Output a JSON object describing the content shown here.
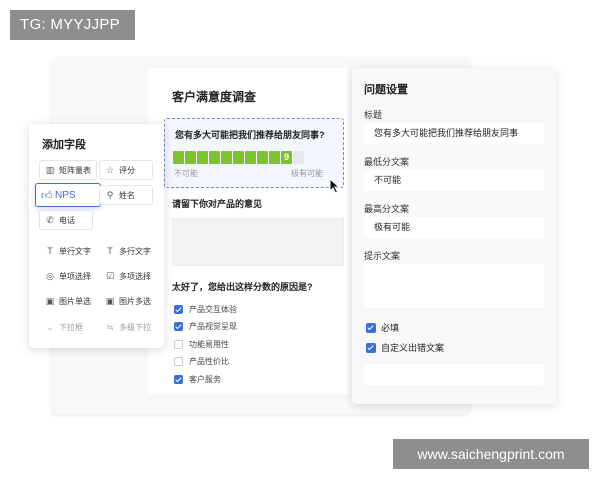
{
  "watermarks": {
    "top": "TG: MYYJJPP",
    "bottom": "www.saichengprint.com"
  },
  "form": {
    "title": "客户满意度调查",
    "nps_question": {
      "label": "您有多大可能把我们推荐给朋友同事?",
      "selected_score": "9",
      "min_label": "不可能",
      "max_label": "极有可能"
    },
    "text_question": {
      "label": "请留下你对产品的意见"
    },
    "reason_question": {
      "label": "太好了，您给出这样分数的原因是?",
      "options": [
        {
          "label": "产品交互体验",
          "checked": true
        },
        {
          "label": "产品视觉呈现",
          "checked": true
        },
        {
          "label": "功能易用性",
          "checked": false
        },
        {
          "label": "产品性价比",
          "checked": false
        },
        {
          "label": "客户服务",
          "checked": true
        }
      ]
    }
  },
  "add_field_panel": {
    "title": "添加字段",
    "buttons": [
      {
        "label": "矩阵量表",
        "icon": "matrix-icon"
      },
      {
        "label": "评分",
        "icon": "star-icon"
      },
      {
        "label": "NPS",
        "icon": "thumbs-up-icon"
      },
      {
        "label": "姓名",
        "icon": "person-icon"
      },
      {
        "label": "电话",
        "icon": "phone-icon"
      },
      {
        "label": "单行文字",
        "icon": "text-icon"
      },
      {
        "label": "多行文字",
        "icon": "text-icon"
      },
      {
        "label": "单项选择",
        "icon": "check-circle-icon"
      },
      {
        "label": "多项选择",
        "icon": "check-square-icon"
      },
      {
        "label": "图片单选",
        "icon": "image-icon"
      },
      {
        "label": "图片多选",
        "icon": "image-icon"
      },
      {
        "label": "下拉框",
        "icon": "chevron-down-icon"
      },
      {
        "label": "多级下拉",
        "icon": "hierarchy-icon"
      }
    ]
  },
  "settings_panel": {
    "title": "问题设置",
    "title_label": "标题",
    "title_value": "您有多大可能把我们推荐给朋友同事",
    "min_label": "最低分文案",
    "min_value": "不可能",
    "max_label": "最高分文案",
    "max_value": "极有可能",
    "hint_label": "提示文案",
    "required_label": "必填",
    "custom_error_label": "自定义出错文案"
  },
  "colors": {
    "accent": "#3b6fd9",
    "nps_fill": "#7cc12e"
  }
}
